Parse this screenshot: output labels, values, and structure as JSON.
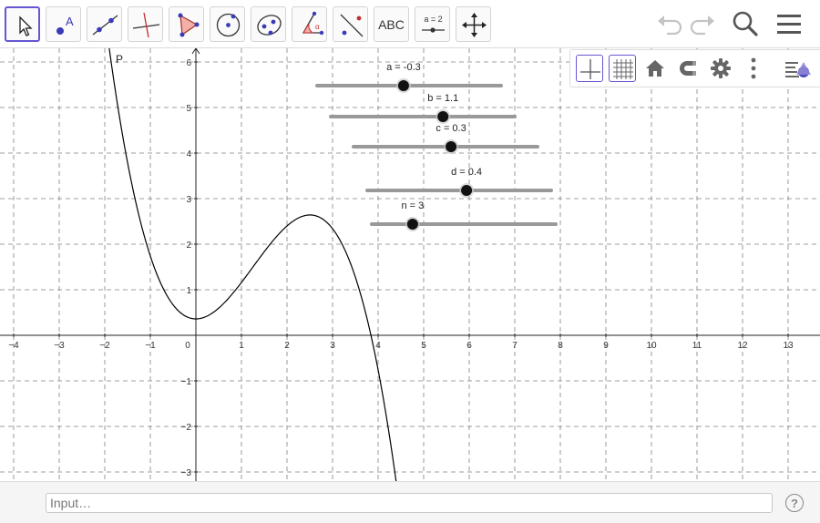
{
  "toolbar": {
    "tools": [
      {
        "name": "move-tool-button",
        "icon": "arrow-cursor-icon",
        "active": true
      },
      {
        "name": "point-tool-button",
        "icon": "point-icon"
      },
      {
        "name": "line-tool-button",
        "icon": "line-through-points-icon"
      },
      {
        "name": "perpendicular-line-tool-button",
        "icon": "perpendicular-line-icon"
      },
      {
        "name": "polygon-tool-button",
        "icon": "polygon-icon"
      },
      {
        "name": "circle-tool-button",
        "icon": "circle-center-point-icon"
      },
      {
        "name": "conic-tool-button",
        "icon": "ellipse-icon"
      },
      {
        "name": "angle-tool-button",
        "icon": "angle-icon"
      },
      {
        "name": "reflect-tool-button",
        "icon": "reflect-about-line-icon"
      },
      {
        "name": "text-tool-button",
        "icon": "text-icon",
        "label": "ABC"
      },
      {
        "name": "slider-tool-button",
        "icon": "slider-icon",
        "label": "a = 2"
      },
      {
        "name": "move-graphics-view-tool-button",
        "icon": "move-arrows-icon"
      }
    ],
    "right_icons": [
      "undo-icon",
      "redo-icon",
      "search-icon",
      "menu-icon"
    ]
  },
  "stylebar": {
    "buttons": [
      "show-axes-icon",
      "show-grid-icon",
      "home-icon",
      "point-capturing-magnet-icon",
      "settings-gear-icon",
      "more-vertical-icon",
      "style-bar-toggle-icon"
    ]
  },
  "graphics": {
    "x_ticks": [
      "-4",
      "-3",
      "-2",
      "-1",
      "0",
      "1",
      "2",
      "3",
      "4",
      "5",
      "6",
      "7",
      "8",
      "9",
      "10",
      "11",
      "12",
      "13"
    ],
    "y_ticks": [
      "6",
      "5",
      "4",
      "3",
      "2",
      "1",
      "-1",
      "-2",
      "-3"
    ],
    "x_range": [
      -4.3,
      13.7
    ],
    "y_range": [
      -3.2,
      6.3
    ],
    "function_label": "P",
    "sliders": [
      {
        "label": "a = -0.3",
        "value": -0.3
      },
      {
        "label": "b = 1.1",
        "value": 1.1
      },
      {
        "label": "c = 0.3",
        "value": 0.3
      },
      {
        "label": "d = 0.4",
        "value": 0.4
      },
      {
        "label": "n = 3",
        "value": 3
      }
    ]
  },
  "input_bar": {
    "placeholder": "Input…",
    "help_label": "?"
  },
  "colors": {
    "accent": "#6557d2",
    "curve": "#000000",
    "grid": "#808080",
    "slider_track": "#999999"
  }
}
